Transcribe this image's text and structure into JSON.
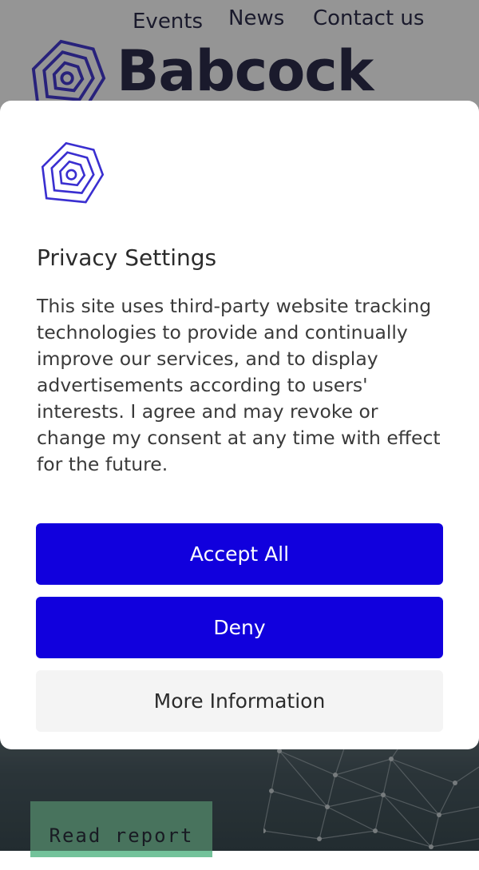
{
  "nav": {
    "events": "Events",
    "news": "News",
    "contact": "Contact us"
  },
  "brand": {
    "name": "Babcock",
    "logo_icon": "babcock-logo-icon"
  },
  "hero": {
    "read_report": "Read report"
  },
  "modal": {
    "title": "Privacy Settings",
    "body": "This site uses third-party website tracking technologies to provide and continually improve our services, and to display advertisements according to users' interests. I agree and may revoke or change my consent at any time with effect for the future.",
    "accept_label": "Accept All",
    "deny_label": "Deny",
    "more_label": "More Information"
  },
  "colors": {
    "primary": "#1100dd",
    "brand_logo": "#3a2fd0",
    "secondary_button": "#f4f4f4",
    "read_report_button": "#73c29a"
  }
}
